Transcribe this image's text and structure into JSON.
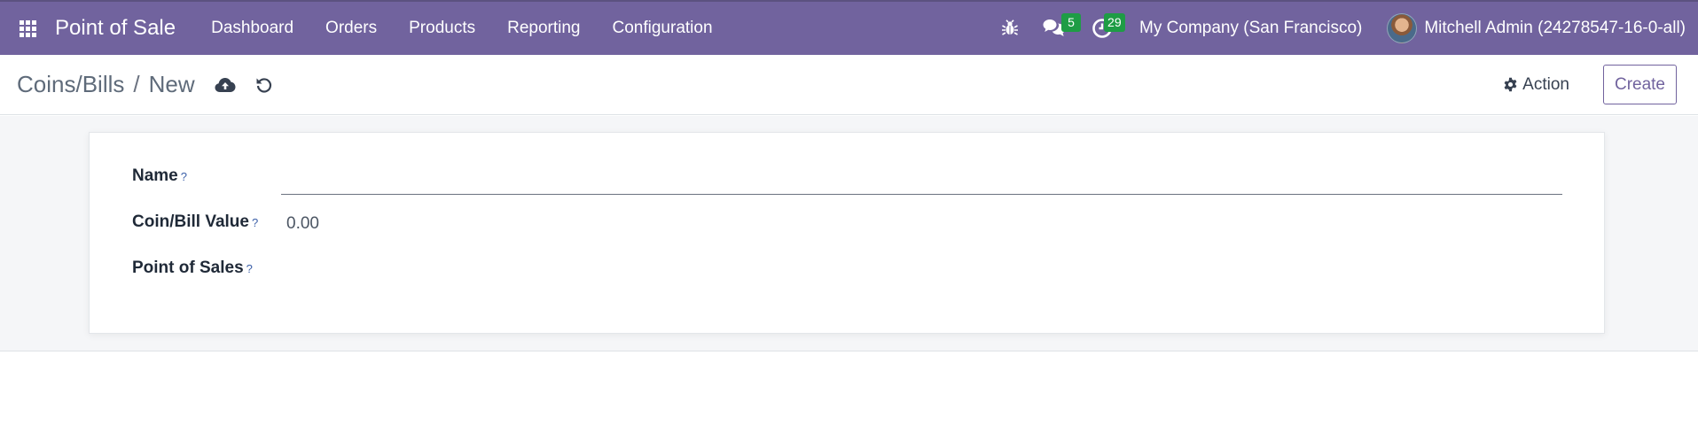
{
  "navbar": {
    "brand": "Point of Sale",
    "menu": [
      "Dashboard",
      "Orders",
      "Products",
      "Reporting",
      "Configuration"
    ],
    "messages_count": "5",
    "activities_count": "29",
    "company": "My Company (San Francisco)",
    "user": "Mitchell Admin (24278547-16-0-all)"
  },
  "control_panel": {
    "breadcrumb_parent": "Coins/Bills",
    "breadcrumb_separator": "/",
    "breadcrumb_current": "New",
    "action_label": "Action",
    "create_label": "Create"
  },
  "form": {
    "name_label": "Name",
    "name_value": "",
    "value_label": "Coin/Bill Value",
    "value_value": "0.00",
    "pos_label": "Point of Sales",
    "help_mark": "?"
  },
  "colors": {
    "brand": "#71639e",
    "badge": "#1e9c45"
  }
}
